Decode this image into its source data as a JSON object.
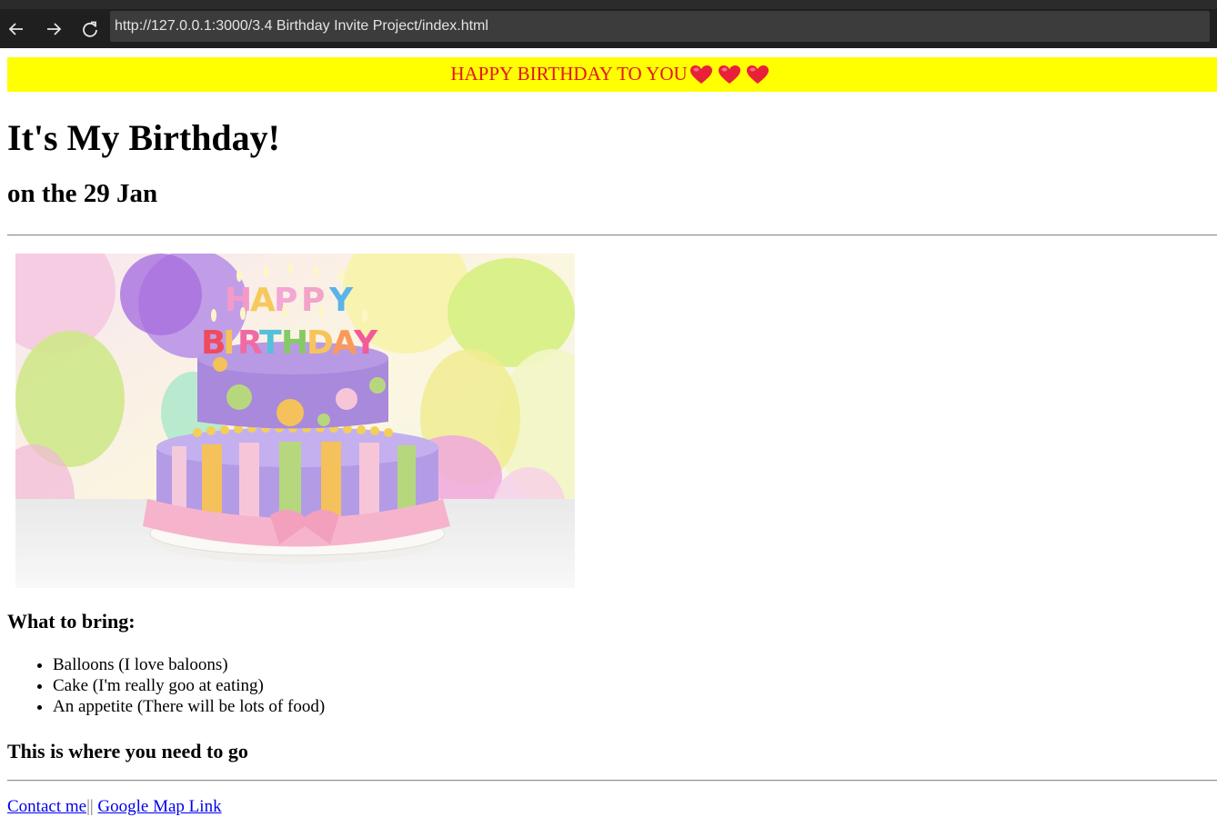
{
  "browser": {
    "url": "http://127.0.0.1:3000/3.4 Birthday Invite Project/index.html",
    "back_icon": "arrow-left-icon",
    "forward_icon": "arrow-right-icon",
    "reload_icon": "reload-icon"
  },
  "banner": {
    "text": "HAPPY BIRTHDAY TO YOU",
    "heart_count": 3,
    "background": "#ffff00",
    "text_color": "#e3161b"
  },
  "page": {
    "title": "It's My Birthday!",
    "date_line": "on the 29 Jan",
    "image_letters": "HAPPY BIRTHDAY",
    "bring_heading": "What to bring:",
    "bring_items": [
      "Balloons (I love baloons)",
      "Cake (I'm really goo at eating)",
      "An appetite (There will be lots of food)"
    ],
    "where_heading": "This is where you need to go"
  },
  "footer": {
    "contact_link": "Contact me",
    "separator": "||",
    "map_link": "Google Map Link",
    "link_color": "#0000ee"
  }
}
